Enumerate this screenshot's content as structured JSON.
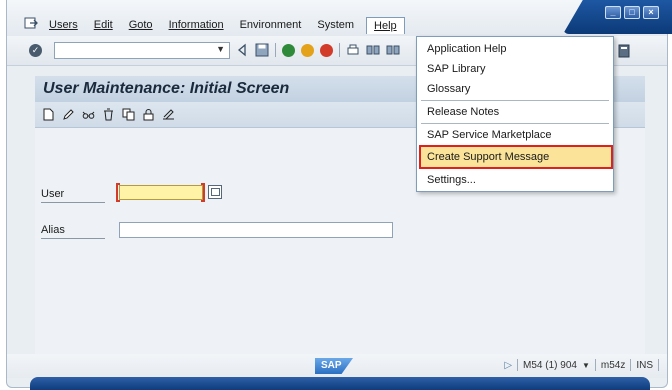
{
  "menubar": {
    "items": [
      {
        "label": "Users",
        "accel": "U"
      },
      {
        "label": "Edit",
        "accel": "E"
      },
      {
        "label": "Goto",
        "accel": "G"
      },
      {
        "label": "Information",
        "accel": "I"
      },
      {
        "label": "Environment",
        "accel": "v"
      },
      {
        "label": "System",
        "accel": "y"
      },
      {
        "label": "Help",
        "accel": "H"
      }
    ]
  },
  "toolbar": {
    "command_field_value": ""
  },
  "screen": {
    "title": "User Maintenance: Initial Screen"
  },
  "form": {
    "user_label": "User",
    "user_value": "",
    "alias_label": "Alias",
    "alias_value": ""
  },
  "help_menu": {
    "items": [
      "Application Help",
      "SAP Library",
      "Glossary",
      "Release Notes",
      "SAP Service Marketplace",
      "Create Support Message",
      "Settings..."
    ],
    "highlighted": "Create Support Message"
  },
  "statusbar": {
    "logo": "SAP",
    "system": "M54 (1) 904",
    "server": "m54z",
    "mode": "INS"
  },
  "colors": {
    "highlight_border": "#e02020",
    "highlight_fill": "#fbe49a",
    "required_field": "#fef3a6",
    "window_frame": "#0e3c7c"
  }
}
